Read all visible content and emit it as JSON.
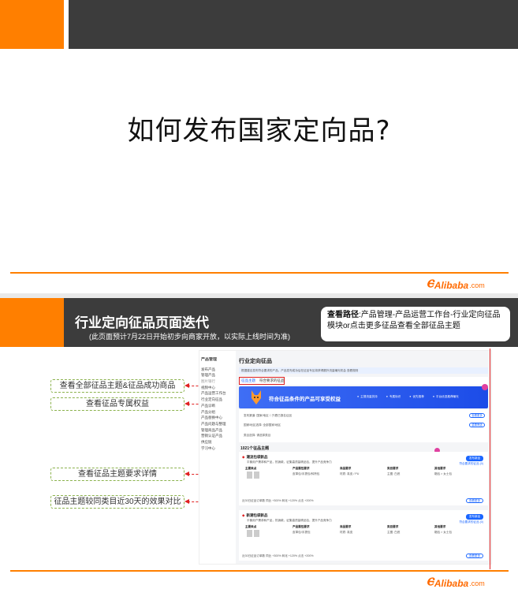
{
  "slide1": {
    "title": "如何发布国家定向品?"
  },
  "brand": {
    "logo_mark": "ⲉ",
    "logo_word": "Alibaba",
    "logo_domain": ".com",
    "accent_color": "#ff7f00",
    "header_color": "#3c3c3c"
  },
  "slide2": {
    "title": "行业定向征品页面迭代",
    "subtitle": "(此页面预计7月22日开始初步向商家开放，以实际上线时间为准)",
    "path_label": "查看路径",
    "path_text": ":产品管理-产品运营工作台-行业定向征品模块or点击更多征品查看全部征品主题",
    "callouts": [
      "查看全部征品主题&征品成功商品",
      "查看征品专属权益",
      "查看征品主题要求详情",
      "征品主题较同类目近30天的效果对比"
    ]
  },
  "screenshot": {
    "sidebar_header": "产品管理",
    "sidebar_items": [
      "发布产品",
      "管理产品",
      "图片银行",
      "视频中心",
      "产品运营工作台",
      "行业定向征品",
      "产品诊断",
      "产品分组",
      "产品替换中心",
      "产品问题与整理",
      "管理商品产品",
      "营销认证产品",
      "供应链",
      "学习中心"
    ],
    "page_title": "行业定向征品",
    "notice": "根据建议发布符合要求的产品，产品发布成功后在征品专区将获得额外流量曝光机会  查看规则",
    "tabs": [
      "征品主题",
      "符合要求的征品"
    ],
    "banner_title": "符合征品条件的产品可享受权益",
    "banner_items": [
      "主搜流量扶持",
      "专属标识",
      "优先推荐",
      "平台优选推荐曝光"
    ],
    "filters": [
      "发布渠道:  国家/地区   □  只看已报名征品",
      "国家/地区选择:  全部国家/地区",
      "类目选择:  请选择类目"
    ],
    "filter_buttons": [
      "查看更多",
      "重置筛选"
    ],
    "count_label": "1021个征品主题",
    "cards": [
      {
        "name": "潮流包袋新品",
        "desc": "平衡用户需求和产品，热销款，征集高质量精品包，提升产品竞争力",
        "button": "发布新品",
        "link": "符合要求的征品 (0)",
        "col_headers": [
          "主要卖点",
          "产品属性要求",
          "商品要求",
          "类目要求",
          "其他要求"
        ],
        "col_values": [
          "皮革包/手提包/斜挎包",
          "材质: 真皮 / PU",
          "主图: 白底",
          "箱包 > 女士包",
          "英语 / 中文"
        ],
        "footer": "近30日征品订单数  同比 +300%  转化 +120%  点击 +200%",
        "footer_btn": "查看更多",
        "metrics": [
          "+300%",
          "+120%",
          "+200%"
        ]
      },
      {
        "name": "新潮包袋新品",
        "desc": "平衡用户需求和产品，热销款，征集高质量精品包，提升产品竞争力",
        "button": "发布新品",
        "link": "符合要求的征品 (0)",
        "col_headers": [
          "主要卖点",
          "产品属性要求",
          "商品要求",
          "类目要求",
          "其他要求"
        ],
        "col_values": [
          "皮革包/手提包",
          "材质: 真皮",
          "主图: 白底",
          "箱包 > 女士包",
          "英语 / 中文"
        ],
        "footer": "近30日征品订单数  同比 +300%  转化 +120%  点击 +200%",
        "footer_btn": "查看更多",
        "metrics": [
          "+300%",
          "+120%",
          "+200%"
        ]
      }
    ]
  }
}
